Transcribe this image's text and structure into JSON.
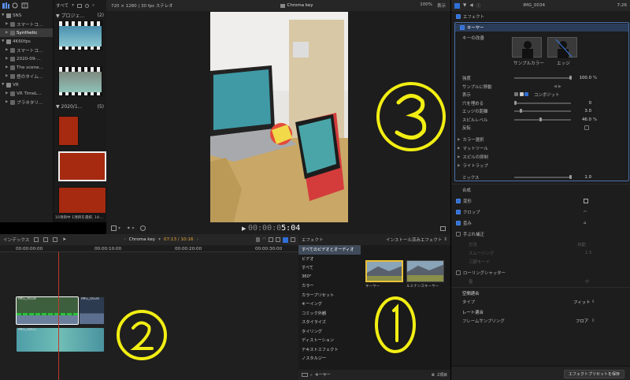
{
  "library": {
    "items": [
      {
        "label": "SNS",
        "level": 0,
        "open": true
      },
      {
        "label": "スマートコ...",
        "level": 1
      },
      {
        "label": "Synthetic",
        "level": 1,
        "selected": true
      },
      {
        "label": "4K60fps",
        "level": 0,
        "open": true
      },
      {
        "label": "スマートコ...",
        "level": 1
      },
      {
        "label": "2020-09-...",
        "level": 1
      },
      {
        "label": "The scene...",
        "level": 1
      },
      {
        "label": "昼のタイム...",
        "level": 1
      },
      {
        "label": "VR",
        "level": 0,
        "open": true
      },
      {
        "label": "VR TimeL...",
        "level": 1
      },
      {
        "label": "プラネタリ...",
        "level": 1
      }
    ]
  },
  "browser": {
    "filter_label": "すべて",
    "group1": "▼ プロジェ...",
    "group1_count": "(2)",
    "group2": "▼ 2020/1...",
    "group2_count": "(5)",
    "footer": "10項目中 1項目を選択, 14:..."
  },
  "viewer": {
    "format": "720 × 1280 | 30 fps ステレオ",
    "title": "Chroma key",
    "zoom": "100%",
    "view_menu": "表示",
    "timecode_dim": "00:00:0",
    "timecode_bright": "5:04"
  },
  "timeline": {
    "index_tab": "インデックス",
    "project": "Chroma key",
    "position": "07:13 / 10:16",
    "ruler": [
      "00:00:00:00",
      "00:00:10:00",
      "00:00:20:00",
      "00:00:30:00"
    ],
    "clips": [
      "IMG_0034",
      "IMG_0034",
      "IMG_0852"
    ]
  },
  "effects": {
    "header": "エフェクト",
    "installed": "インストール済みエフェクト",
    "categories": [
      "すべてのビデオとオーディオ",
      "ビデオ",
      "すべて",
      "360°",
      "カラー",
      "カラープリセット",
      "キーイング",
      "コミック外観",
      "スタイライズ",
      "タイリング",
      "ディストーション",
      "テキストエフェクト",
      "ノスタルジー"
    ],
    "items": [
      "キーヤー",
      "ルミナンスキーヤー"
    ],
    "search_value": "キーヤー",
    "count": "2項目"
  },
  "inspector": {
    "clip": "IMG_0034",
    "duration": "7:26",
    "effects_section": "エフェクト",
    "keyer": "キーヤー",
    "refine": "キーの改善",
    "sample_color": "サンプルカラー",
    "edge": "エッジ",
    "rows": [
      {
        "label": "強度",
        "value": "100.0",
        "unit": "%",
        "slider": 1.0
      },
      {
        "label": "サンプルに移動",
        "value": "",
        "unit": ""
      },
      {
        "label": "表示",
        "value": "",
        "unit": "",
        "view": "コンポジット"
      },
      {
        "label": "穴を埋める",
        "value": "0",
        "unit": "",
        "slider": 0.0
      },
      {
        "label": "エッジの距離",
        "value": "3.0",
        "unit": "",
        "slider": 0.1
      },
      {
        "label": "スピルレベル",
        "value": "46.0",
        "unit": "%",
        "slider": 0.46
      },
      {
        "label": "反転",
        "value": "",
        "unit": ""
      }
    ],
    "groups": [
      "カラー選択",
      "マットツール",
      "スピルの抑制",
      "ライトラップ"
    ],
    "mix_label": "ミックス",
    "mix_value": "1.0",
    "composite": "合成",
    "transform": "変形",
    "crop": "クロップ",
    "distort": "歪み",
    "stabilize": "手ぶれ補正",
    "stab_rows": [
      "方法",
      "スムージング",
      "三脚モード"
    ],
    "stab_method": "自動",
    "stab_smooth": "1.5",
    "rolling": "ローリングシャッター",
    "rolling_row": "量",
    "rolling_value": "中",
    "spatial": "空間適合",
    "type_label": "タイプ",
    "type_value": "フィット",
    "rate": "レート適合",
    "frame_sampling": "フレームサンプリング",
    "frame_value": "フロア",
    "save_preset": "エフェクトプリセットを保存"
  },
  "annotations": [
    "①",
    "②",
    "③"
  ],
  "colors": {
    "annotation": "#f2ee13",
    "accent": "#2f6fd6",
    "selected_clip": "#9fb7d6"
  }
}
